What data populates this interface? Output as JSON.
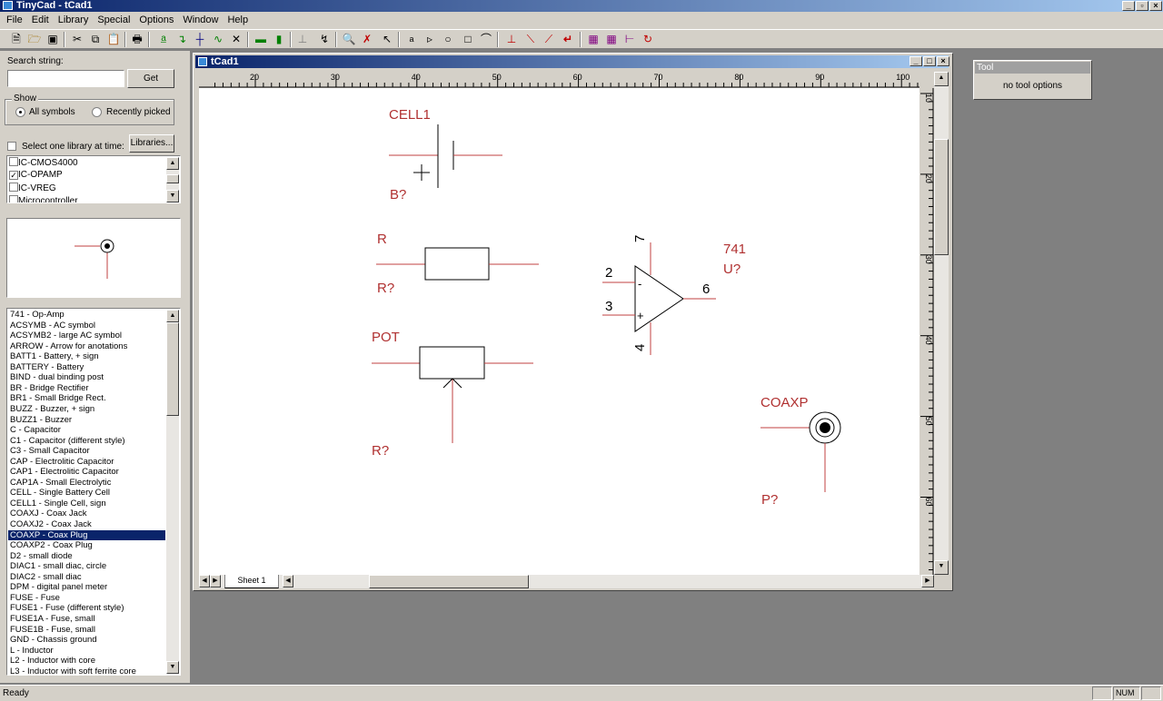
{
  "app": {
    "title": "TinyCad - tCad1"
  },
  "menu": [
    "File",
    "Edit",
    "Library",
    "Special",
    "Options",
    "Window",
    "Help"
  ],
  "toolbar": {
    "icons": [
      "new-icon",
      "open-icon",
      "save-icon",
      "cut-icon",
      "copy-icon",
      "paste-icon",
      "print-icon",
      "label-icon",
      "wire-icon",
      "junction-icon",
      "bus-icon",
      "no-connect-icon",
      "power-icon",
      "bus-entry-icon",
      "origin-icon",
      "snap-icon",
      "zoom-icon",
      "delete-icon",
      "select-icon",
      "text-icon",
      "polygon-icon",
      "circle-icon",
      "rectangle-icon",
      "arc-icon",
      "ruler-icon",
      "line-icon",
      "diag-line-icon",
      "bezier-icon",
      "block-icon",
      "block2-icon",
      "rotate-icon",
      "flip-icon"
    ]
  },
  "left": {
    "search_label": "Search string:",
    "search_value": "",
    "get_label": "Get",
    "show_label": "Show",
    "all_symbols": "All symbols",
    "recently_picked": "Recently picked",
    "select_one_label": "Select one library at time:",
    "libraries_button": "Libraries...",
    "libraries": [
      {
        "name": "IC-CMOS4000",
        "checked": false
      },
      {
        "name": "IC-OPAMP",
        "checked": true
      },
      {
        "name": "IC-VREG",
        "checked": false
      },
      {
        "name": "Microcontroller",
        "checked": false
      }
    ],
    "symbols": [
      "741 - Op-Amp",
      "ACSYMB - AC symbol",
      "ACSYMB2 - large AC symbol",
      "ARROW - Arrow for anotations",
      "BATT1 - Battery, + sign",
      "BATTERY - Battery",
      "BIND - dual binding post",
      "BR - Bridge Rectifier",
      "BR1 - Small Bridge Rect.",
      "BUZZ - Buzzer, + sign",
      "BUZZ1 - Buzzer",
      "C - Capacitor",
      "C1 - Capacitor (different style)",
      "C3 - Small Capacitor",
      "CAP - Electrolitic Capacitor",
      "CAP1 - Electrolitic Capacitor",
      "CAP1A - Small Electrolytic",
      "CELL - Single Battery Cell",
      "CELL1 - Single Cell,  sign",
      "COAXJ - Coax Jack",
      "COAXJ2 - Coax Jack",
      "COAXP - Coax Plug",
      "COAXP2 - Coax Plug",
      "D2 - small diode",
      "DIAC1 - small diac, circle",
      "DIAC2 - small diac",
      "DPM - digital panel meter",
      "FUSE - Fuse",
      "FUSE1 - Fuse (different style)",
      "FUSE1A - Fuse, small",
      "FUSE1B - Fuse, small",
      "GND - Chassis ground",
      "L - Inductor",
      "L2 - Inductor with core",
      "L3 - Inductor with soft ferrite core"
    ],
    "selected_symbol": "COAXP - Coax Plug"
  },
  "doc": {
    "title": "tCad1",
    "sheet_tab": "Sheet 1",
    "hruler_ticks": [
      "20",
      "30",
      "40",
      "50",
      "60",
      "70",
      "80",
      "90",
      "100"
    ],
    "vruler_ticks": [
      "10",
      "20",
      "30",
      "40",
      "50",
      "60"
    ]
  },
  "schematic": {
    "cell": {
      "name": "CELL1",
      "ref": "B?"
    },
    "resistor": {
      "name": "R",
      "ref": "R?"
    },
    "pot": {
      "name": "POT",
      "ref": "R?"
    },
    "opamp": {
      "name": "741",
      "ref": "U?",
      "pins": [
        "7",
        "2",
        "3",
        "6",
        "4"
      ],
      "minus": "-",
      "plus": "+"
    },
    "coax": {
      "name": "COAXP",
      "ref": "P?"
    }
  },
  "tool": {
    "header": "Tool",
    "text": "no tool options"
  },
  "status": {
    "text": "Ready",
    "num": "NUM"
  }
}
